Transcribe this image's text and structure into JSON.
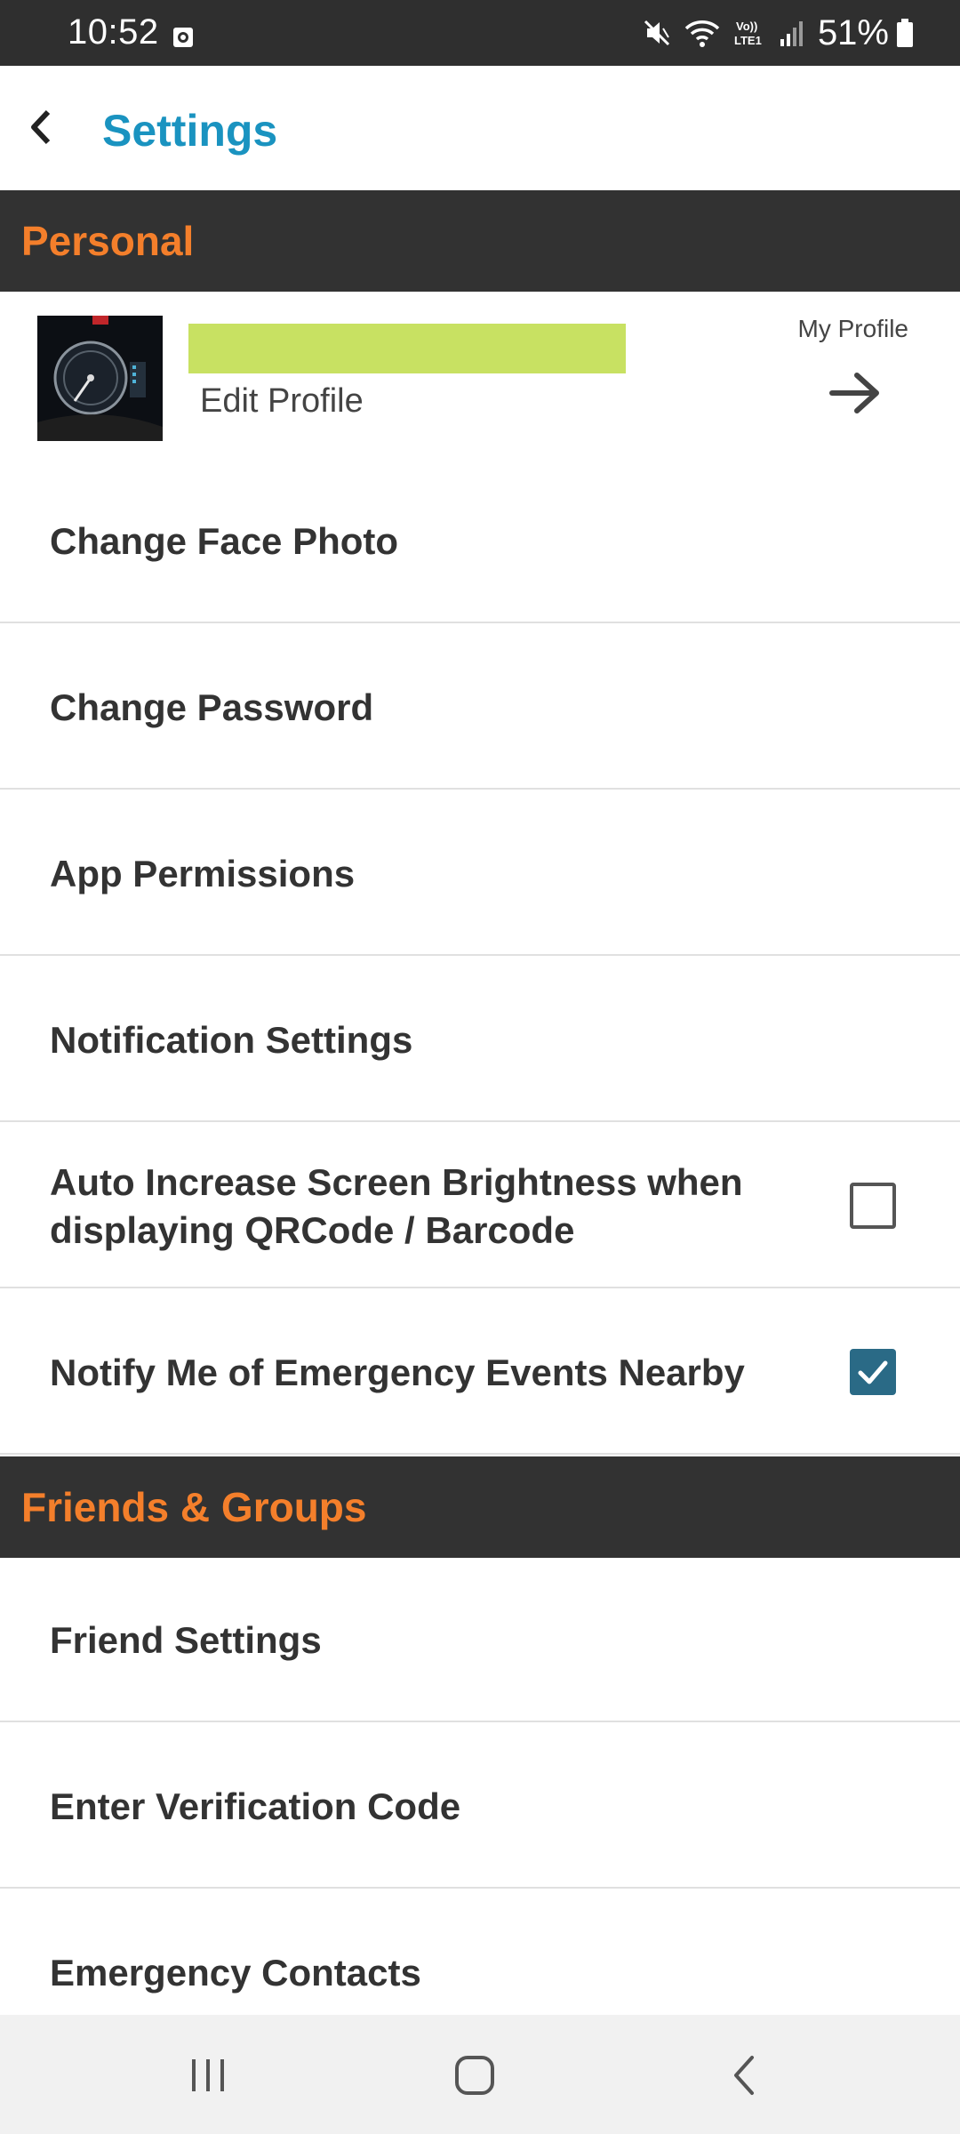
{
  "status_bar": {
    "time": "10:52",
    "battery": "51%",
    "icons": [
      "screenshot-icon",
      "mute-icon",
      "wifi-icon",
      "volte-icon",
      "signal-icon",
      "battery-icon"
    ]
  },
  "header": {
    "title": "Settings",
    "back_icon": "chevron-left-icon"
  },
  "sections": {
    "personal": "Personal",
    "friends_groups": "Friends & Groups"
  },
  "profile": {
    "edit_label": "Edit Profile",
    "my_profile_label": "My Profile",
    "name_redaction_color": "#c8e162"
  },
  "personal_items": [
    {
      "label": "Change Face Photo"
    },
    {
      "label": "Change Password"
    },
    {
      "label": "App Permissions"
    },
    {
      "label": "Notification Settings"
    },
    {
      "label": "Auto Increase Screen Brightness when displaying QRCode / Barcode",
      "checked": false
    },
    {
      "label": "Notify Me of Emergency Events Nearby",
      "checked": true
    }
  ],
  "friends_items": [
    {
      "label": "Friend Settings"
    },
    {
      "label": "Enter Verification Code"
    },
    {
      "label": "Emergency Contacts"
    }
  ],
  "colors": {
    "accent_title": "#1a93c0",
    "section_text": "#f47f2b",
    "section_bg": "#323232",
    "checkbox_checked": "#2a6a86"
  },
  "nav_bar": [
    "recents-icon",
    "home-icon",
    "back-icon"
  ]
}
